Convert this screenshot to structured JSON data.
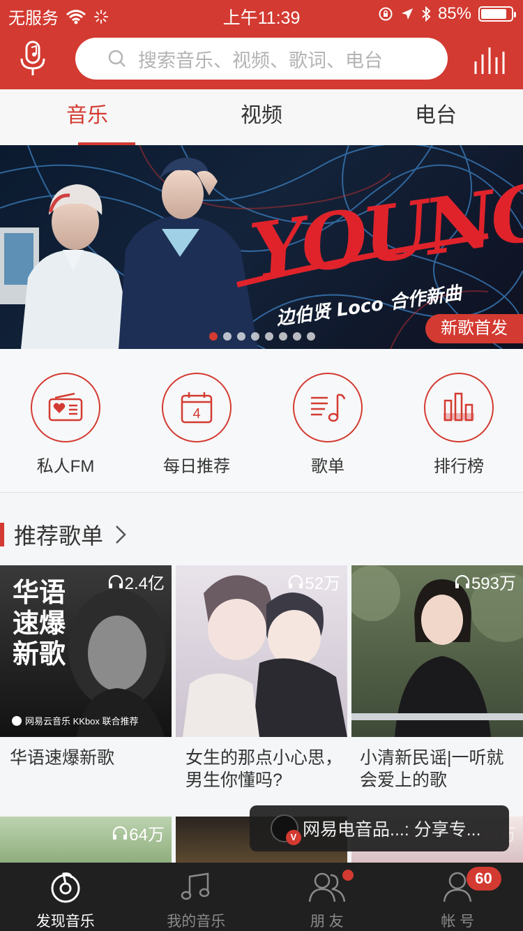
{
  "statusbar": {
    "carrier": "无服务",
    "time": "上午11:39",
    "battery": "85%"
  },
  "search": {
    "placeholder": "搜索音乐、视频、歌词、电台"
  },
  "tabs": [
    {
      "label": "音乐",
      "active": true
    },
    {
      "label": "视频",
      "active": false
    },
    {
      "label": "电台",
      "active": false
    }
  ],
  "banner": {
    "headline": "YOUNG",
    "subtitle": "边伯贤 Loco 合作新曲",
    "tag": "新歌首发",
    "dots": 8,
    "active_dot": 0
  },
  "shortcuts": [
    {
      "label": "私人FM",
      "icon": "radio-heart-icon"
    },
    {
      "label": "每日推荐",
      "icon": "calendar-icon",
      "day": "4"
    },
    {
      "label": "歌单",
      "icon": "playlist-icon"
    },
    {
      "label": "排行榜",
      "icon": "ranking-bars-icon"
    }
  ],
  "section": {
    "title": "推荐歌单"
  },
  "playlists": [
    {
      "title": "华语速爆新歌",
      "plays": "2.4亿",
      "cover_text": "华语\n速爆\n新歌",
      "cover_footer": "网易云音乐 KKbox 联合推荐"
    },
    {
      "title": "女生的那点小心思，男生你懂吗?",
      "plays": "52万"
    },
    {
      "title": "小清新民谣|一听就会爱上的歌",
      "plays": "593万"
    },
    {
      "title": "",
      "plays": "64万"
    },
    {
      "title": "",
      "plays": ""
    },
    {
      "title": "",
      "plays": "13万"
    }
  ],
  "toast": {
    "text": "网易电音品...: 分享专..."
  },
  "nav": [
    {
      "label": "发现音乐",
      "active": true
    },
    {
      "label": "我的音乐",
      "active": false
    },
    {
      "label": "朋 友",
      "active": false
    },
    {
      "label": "帐 号",
      "active": false,
      "badge": "60"
    }
  ],
  "colors": {
    "brand": "#d33a31"
  }
}
